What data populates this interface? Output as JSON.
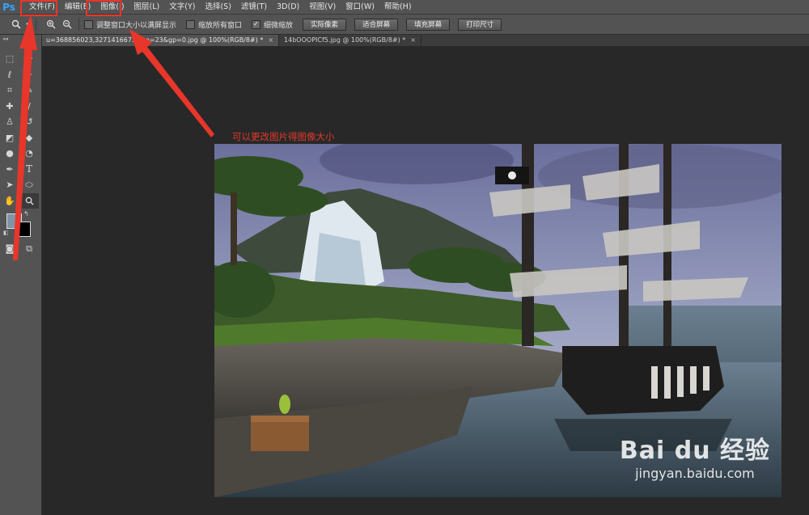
{
  "menubar": {
    "logo": "Ps",
    "items": [
      "文件(F)",
      "编辑(E)",
      "图像(I)",
      "图层(L)",
      "文字(Y)",
      "选择(S)",
      "滤镜(T)",
      "3D(D)",
      "视图(V)",
      "窗口(W)",
      "帮助(H)"
    ]
  },
  "options": {
    "checkboxes": [
      {
        "label": "调整窗口大小以满屏显示",
        "checked": false
      },
      {
        "label": "缩放所有窗口",
        "checked": false
      },
      {
        "label": "细微缩放",
        "checked": true
      }
    ],
    "buttons": [
      "实际像素",
      "适合屏幕",
      "填充屏幕",
      "打印尺寸"
    ]
  },
  "tabs": [
    {
      "label": "u=368856023,3271416673&fm=23&gp=0.jpg @ 100%(RGB/8#) *",
      "close": "×",
      "active": true
    },
    {
      "label": "14bOOOPICf5.jpg @ 100%(RGB/8#) *",
      "close": "×",
      "active": false
    }
  ],
  "toolbar": {
    "grip": "◂◂"
  },
  "annotation": {
    "callout": "可以更改图片得图像大小",
    "color": "#e5382b"
  },
  "watermark": {
    "brand": "Bai du 经验",
    "url": "jingyan.baidu.com"
  }
}
